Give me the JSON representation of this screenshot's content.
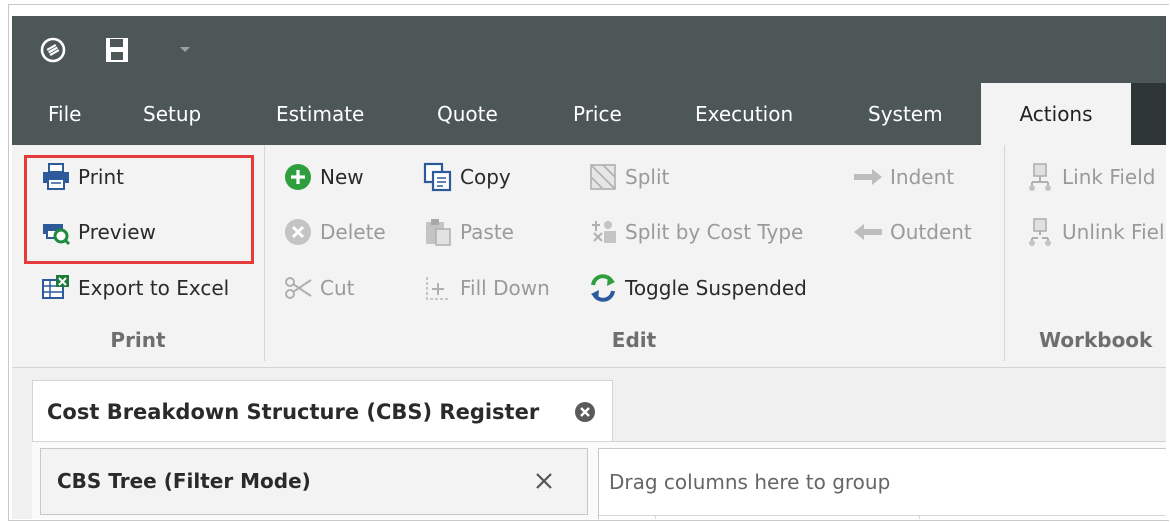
{
  "menu": {
    "items": [
      "File",
      "Setup",
      "Estimate",
      "Quote",
      "Price",
      "Execution",
      "System",
      "Actions"
    ],
    "active": "Actions"
  },
  "ribbon": {
    "print_group": {
      "label": "Print",
      "buttons": {
        "print": "Print",
        "preview": "Preview",
        "export": "Export to Excel"
      }
    },
    "edit_group": {
      "label": "Edit",
      "buttons": {
        "new": "New",
        "delete": "Delete",
        "cut": "Cut",
        "copy": "Copy",
        "paste": "Paste",
        "fill_down": "Fill Down",
        "split": "Split",
        "split_cost": "Split by Cost Type",
        "toggle_suspended": "Toggle Suspended",
        "indent": "Indent",
        "outdent": "Outdent"
      }
    },
    "workbook_group": {
      "label": "Workbook",
      "buttons": {
        "link_field": "Link Field",
        "unlink_field": "Unlink Fiel"
      }
    }
  },
  "document": {
    "tab_title": "Cost Breakdown Structure (CBS) Register",
    "panel_title": "CBS Tree (Filter Mode)",
    "group_hint": "Drag columns here to group"
  },
  "colors": {
    "titlebar": "#4d5757",
    "ribbon_bg": "#f3f3f3",
    "highlight": "#e53b3b",
    "new_green": "#2e9e3e",
    "icon_blue": "#2c5a9b",
    "excel_green": "#1e7a3a"
  },
  "icons": {
    "app": "app-logo-icon",
    "save": "floppy-save-icon",
    "quick_access": "dropdown-arrow-icon",
    "print": "printer-icon",
    "preview": "print-preview-icon",
    "export": "excel-export-icon",
    "new": "plus-circle-icon",
    "delete": "x-circle-icon",
    "cut": "scissors-icon",
    "copy": "copy-icon",
    "paste": "clipboard-icon",
    "fill_down": "fill-down-icon",
    "split": "split-icon",
    "split_cost": "split-cost-type-icon",
    "toggle_suspended": "toggle-arrows-icon",
    "indent": "arrow-right-icon",
    "outdent": "arrow-left-icon",
    "link_field": "link-field-icon",
    "unlink_field": "unlink-field-icon",
    "tab_close": "close-circle-icon",
    "panel_close": "close-icon"
  }
}
